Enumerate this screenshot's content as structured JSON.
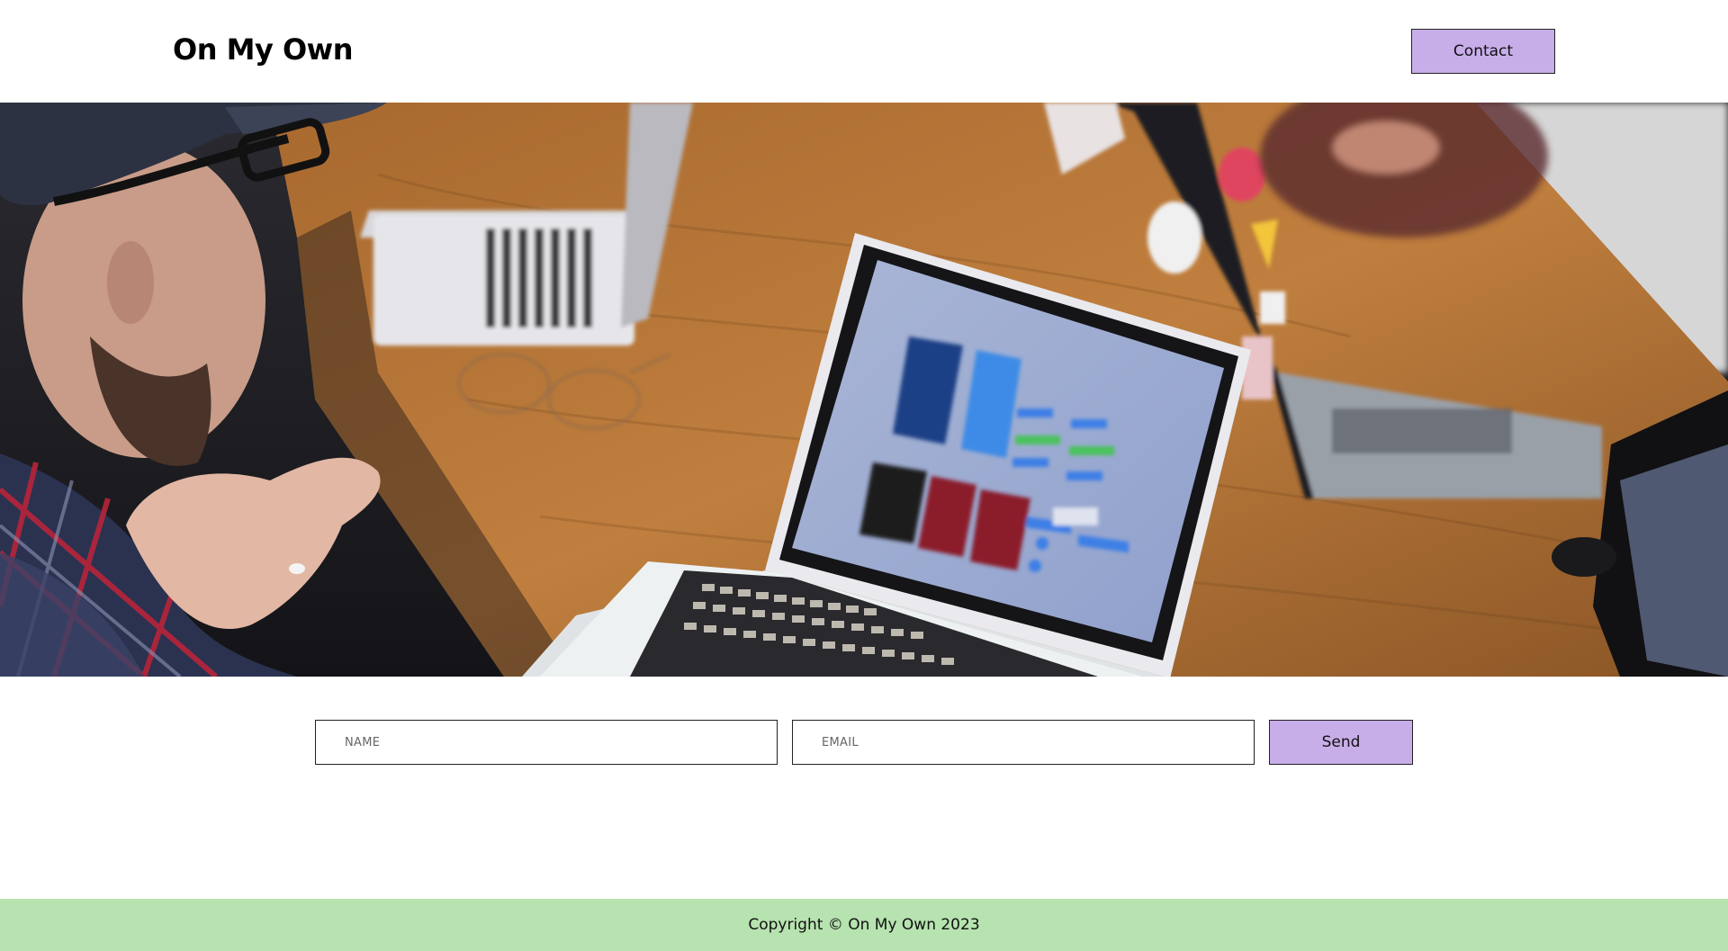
{
  "header": {
    "logo_text": "On My Own",
    "contact_label": "Contact"
  },
  "hero": {
    "image_description": "hero-photo-laptops-on-table"
  },
  "form": {
    "name_placeholder": "NAME",
    "email_placeholder": "EMAIL",
    "send_label": "Send"
  },
  "footer": {
    "copyright": "Copyright © On My Own 2023"
  },
  "colors": {
    "accent_button": "#c8aee9",
    "footer_bg": "#b6e3af",
    "text": "#111111"
  }
}
